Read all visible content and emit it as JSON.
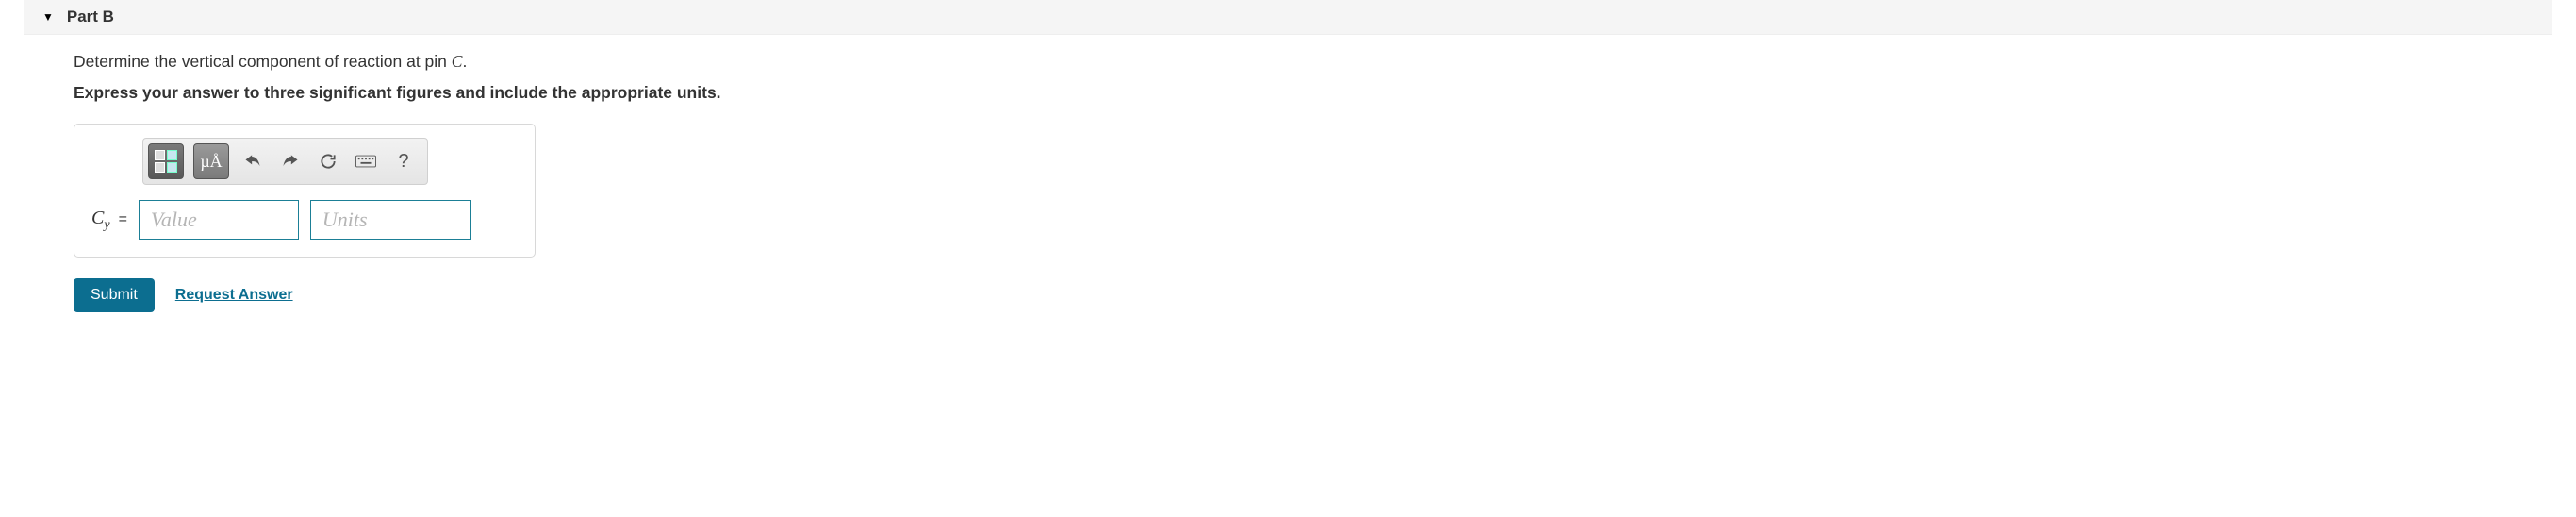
{
  "header": {
    "part_label": "Part B"
  },
  "question": {
    "prompt_prefix": "Determine the vertical component of reaction at pin ",
    "prompt_var": "C",
    "prompt_suffix": ".",
    "instructions": "Express your answer to three significant figures and include the appropriate units."
  },
  "toolbar": {
    "templates_tooltip": "Templates",
    "units_symbol": "µÅ",
    "undo_tooltip": "Undo",
    "redo_tooltip": "Redo",
    "reset_tooltip": "Reset",
    "keyboard_tooltip": "Keyboard shortcuts",
    "help_label": "?"
  },
  "answer": {
    "variable_html": "C",
    "subscript": "y",
    "equals": "=",
    "value_placeholder": "Value",
    "units_placeholder": "Units"
  },
  "actions": {
    "submit_label": "Submit",
    "request_answer_label": "Request Answer"
  }
}
